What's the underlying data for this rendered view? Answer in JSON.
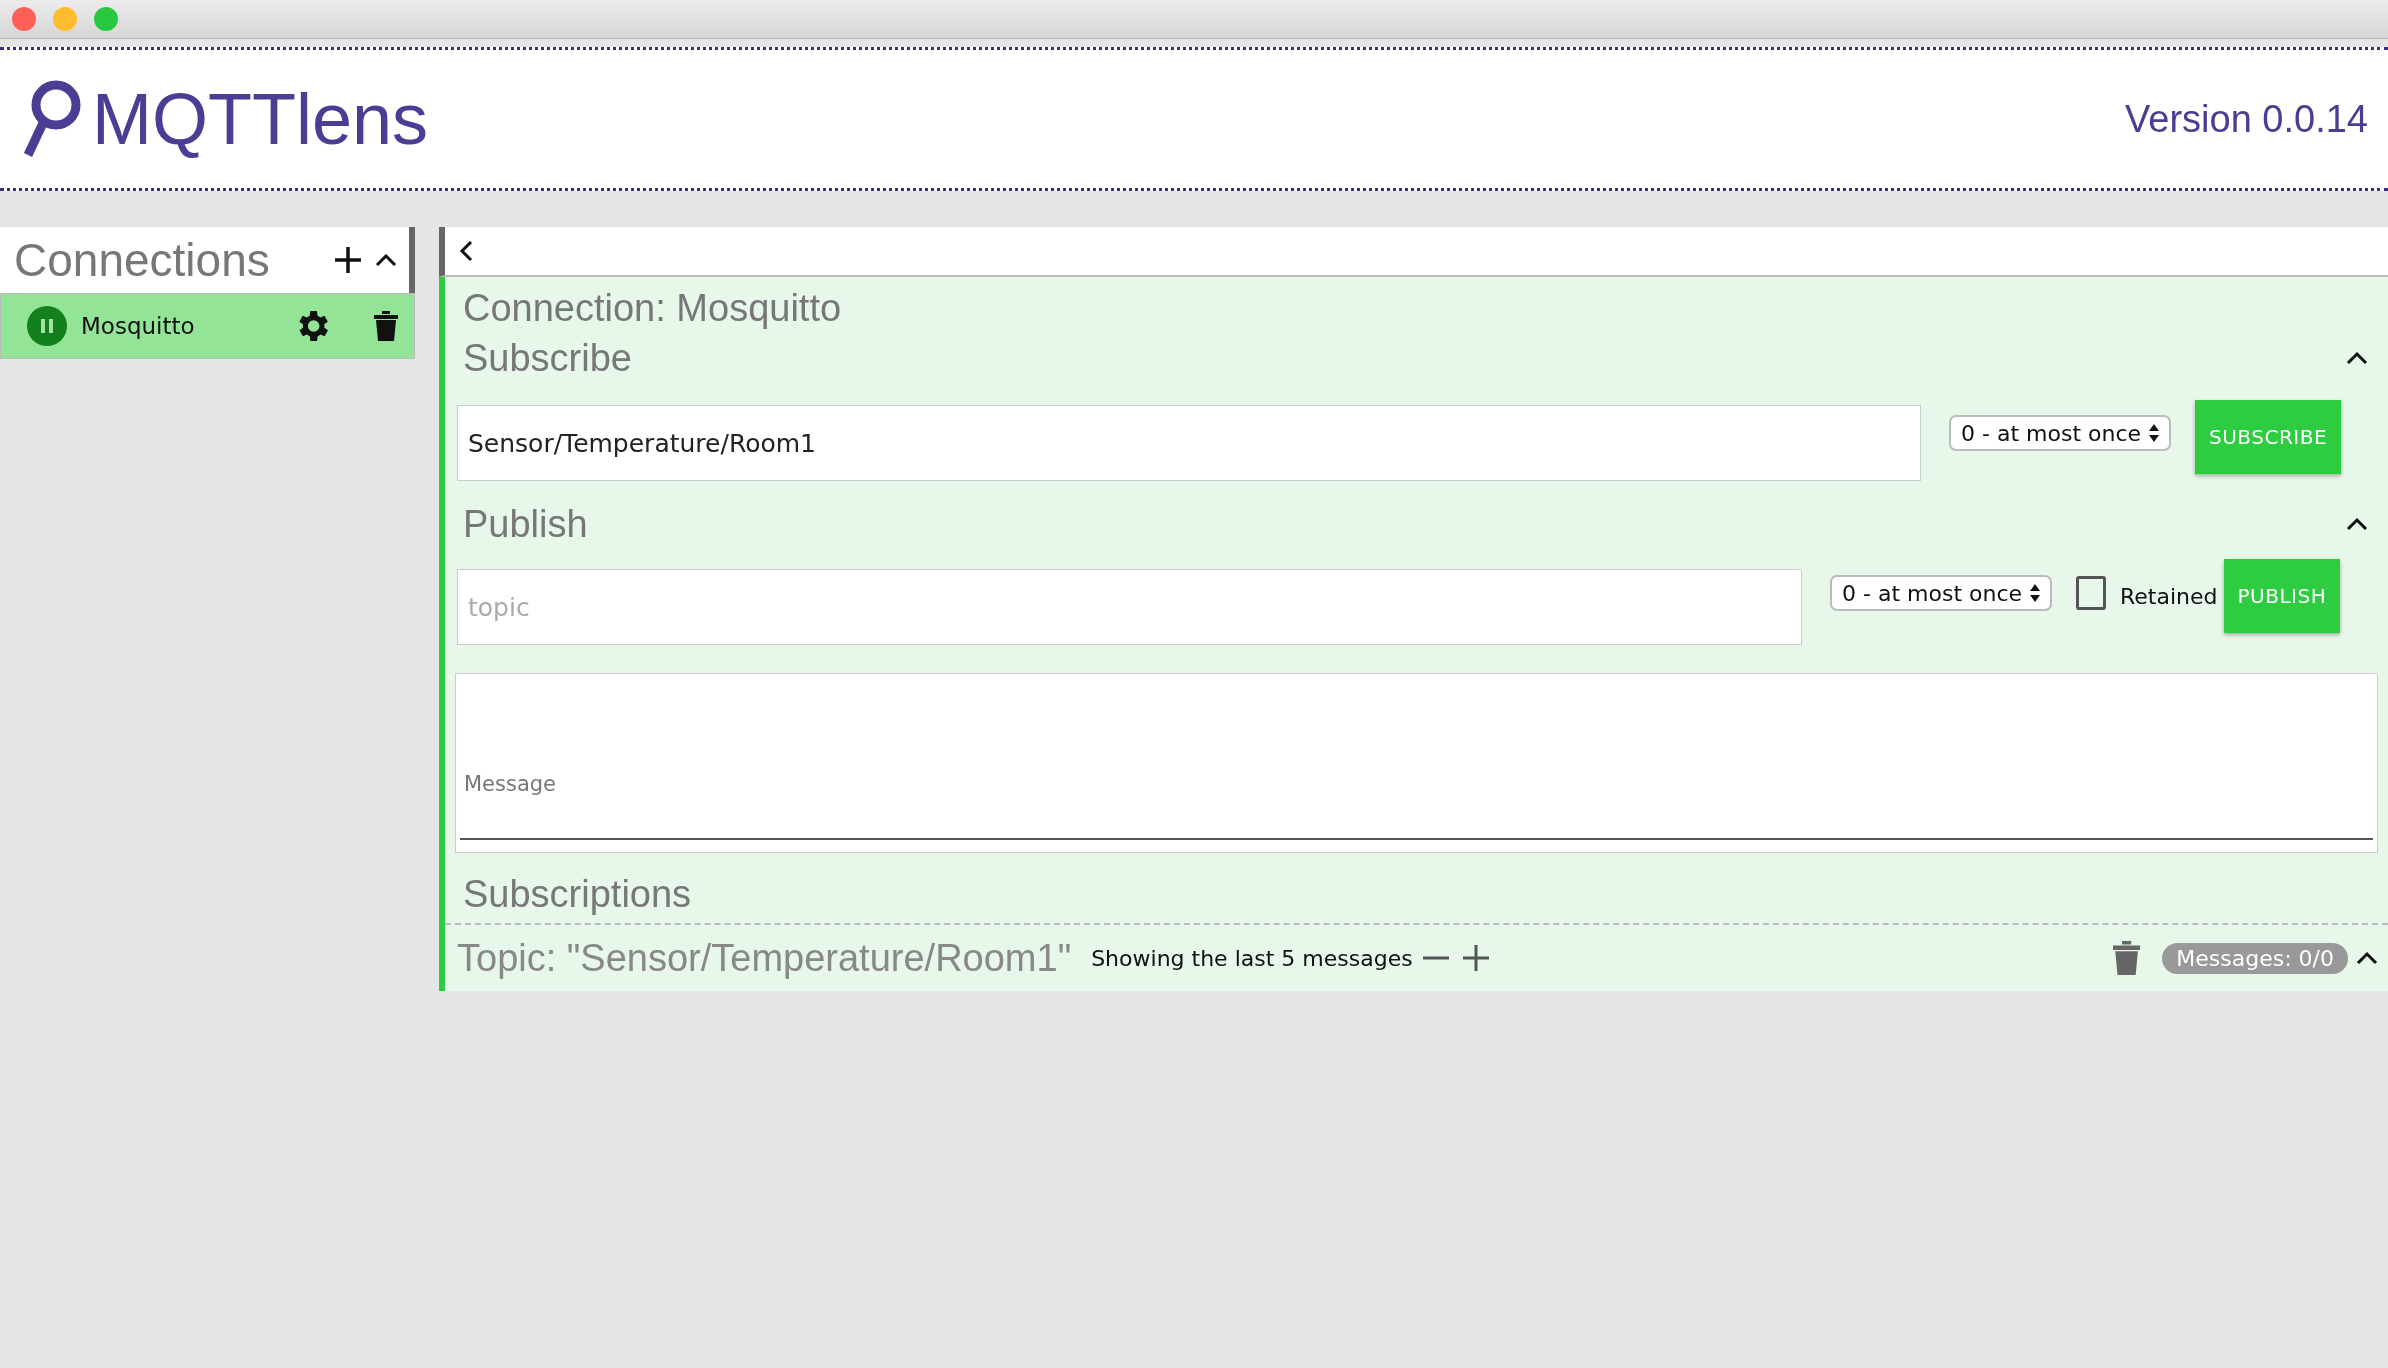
{
  "header": {
    "logo": "MQTTlens",
    "version": "Version 0.0.14"
  },
  "connections": {
    "title": "Connections",
    "expanded": true,
    "items": [
      {
        "name": "Mosquitto",
        "selected": true
      }
    ]
  },
  "connection": {
    "title": "Connection: Mosquitto",
    "subscribe": {
      "title": "Subscribe",
      "expanded": true,
      "topic": "Sensor/Temperature/Room1",
      "qos": "0 - at most once",
      "button": "SUBSCRIBE"
    },
    "publish": {
      "title": "Publish",
      "expanded": true,
      "topic": {
        "placeholder": "topic"
      },
      "qos": "0 - at most once",
      "retained": {
        "label": "Retained",
        "checked": false
      },
      "button": "PUBLISH",
      "message": {
        "placeholder": "Message"
      }
    },
    "subscriptions": {
      "title": "Subscriptions",
      "items": [
        {
          "topic": "Topic: \"Sensor/Temperature/Room1\"",
          "showing": "Showing the last 5 messages",
          "messages": "Messages: 0/0",
          "expanded": true
        }
      ]
    }
  }
}
